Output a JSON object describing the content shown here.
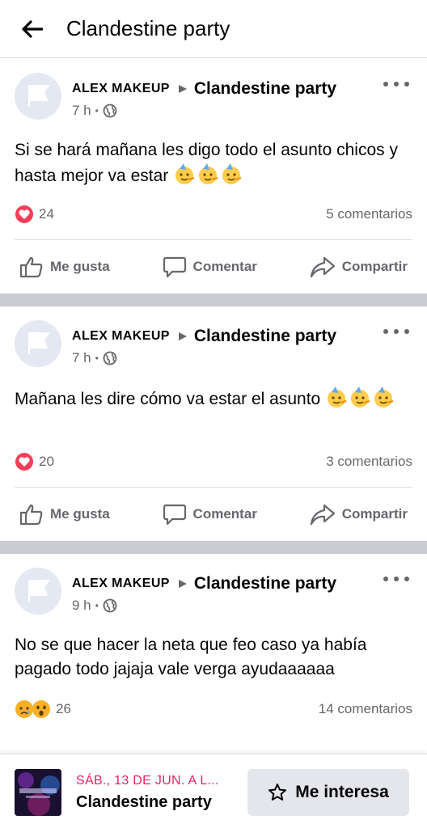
{
  "header": {
    "title": "Clandestine party",
    "back_icon": "arrow-left-icon"
  },
  "posts": [
    {
      "author": "ALEX MAKEUP",
      "group": "Clandestine party",
      "time": "7 h",
      "privacy_icon": "globe-icon",
      "text": "Si se hará mañana les digo  todo el asunto chicos y hasta mejor va estar",
      "emojis": [
        "partying-face",
        "partying-face",
        "partying-face"
      ],
      "reactions": [
        "love"
      ],
      "reaction_count": "24",
      "comments": "5 comentarios"
    },
    {
      "author": "ALEX MAKEUP",
      "group": "Clandestine party",
      "time": "7 h",
      "privacy_icon": "globe-icon",
      "text": "Mañana les dire cómo va estar el asunto",
      "emojis": [
        "partying-face",
        "partying-face",
        "partying-face"
      ],
      "reactions": [
        "love"
      ],
      "reaction_count": "20",
      "comments": "3 comentarios"
    },
    {
      "author": "ALEX MAKEUP",
      "group": "Clandestine party",
      "time": "9 h",
      "privacy_icon": "globe-icon",
      "text": "No se que hacer la neta que feo caso ya había pagado todo jajaja vale verga ayudaaaaaa",
      "emojis": [],
      "reactions": [
        "sad",
        "wow"
      ],
      "reaction_count": "26",
      "comments": "14 comentarios"
    }
  ],
  "actions": {
    "like": "Me gusta",
    "comment": "Comentar",
    "share": "Compartir"
  },
  "event_bar": {
    "date": "SÁB., 13 DE JUN. A L...",
    "name": "Clandestine party",
    "button": "Me interesa",
    "button_icon": "star-icon"
  },
  "colors": {
    "accent_red": "#e0245e",
    "secondary_text": "#65676b",
    "separator": "#c9ccd1",
    "button_bg": "#e4e6eb"
  }
}
